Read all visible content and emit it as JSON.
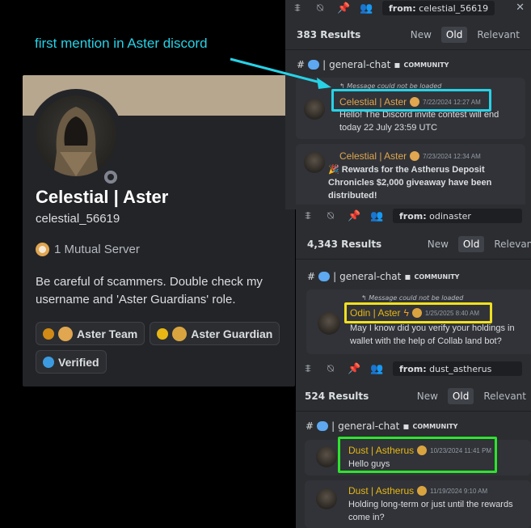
{
  "annotation": {
    "text": "first mention in Aster discord",
    "color": "#27d2e6"
  },
  "profile": {
    "display_name": "Celestial | Aster",
    "handle": "celestial_56619",
    "mutual": "1 Mutual Server",
    "bio": "Be careful of scammers. Double check my username and 'Aster Guardians' role.",
    "roles": [
      {
        "label": "Aster Team",
        "dot_color": "#d08a15"
      },
      {
        "label": "Aster Guardian",
        "dot_color": "#e8b713"
      },
      {
        "label": "Verified",
        "dot_color": "#3c9be0"
      }
    ]
  },
  "panels": [
    {
      "search": {
        "prefix": "from:",
        "query": "celestial_56619"
      },
      "results": "383 Results",
      "sort": [
        "New",
        "Old",
        "Relevant"
      ],
      "active_sort": "Old",
      "channel": "general-chat",
      "category": "COMMUNITY",
      "reply_note": "Message could not be loaded",
      "messages": [
        {
          "author": "Celestial | Aster",
          "time": "7/22/2024 12:27 AM",
          "lines": [
            "Hello! The Discord invite contest will end",
            "today 22 July 23:59 UTC"
          ]
        },
        {
          "author": "Celestial | Aster",
          "time": "7/23/2024 12:34 AM",
          "lines": [
            "🎉 Rewards for the Astherus Deposit",
            "Chronicles $2,000 giveaway have been",
            "distributed!"
          ]
        }
      ],
      "highlight_color": "#27d2e6"
    },
    {
      "search": {
        "prefix": "from:",
        "query": "odinaster"
      },
      "results": "4,343 Results",
      "sort": [
        "New",
        "Old",
        "Relevant"
      ],
      "active_sort": "Old",
      "channel": "general-chat",
      "category": "COMMUNITY",
      "reply_note": "Message could not be loaded",
      "messages": [
        {
          "author": "Odin | Aster",
          "time": "1/25/2025 8:40 AM",
          "lines": [
            "May I know did you verify your holdings in",
            "wallet with the help of Collab land bot?"
          ]
        }
      ],
      "highlight_color": "#f0e020"
    },
    {
      "search": {
        "prefix": "from:",
        "query": "dust_astherus"
      },
      "results": "524 Results",
      "sort": [
        "New",
        "Old",
        "Relevant"
      ],
      "active_sort": "Old",
      "channel": "general-chat",
      "category": "COMMUNITY",
      "messages": [
        {
          "author": "Dust | Astherus",
          "time": "10/23/2024 11:41 PM",
          "lines": [
            "Hello guys"
          ]
        },
        {
          "author": "Dust | Astherus",
          "time": "11/19/2024 9:10 AM",
          "lines": [
            "Holding long-term or just until the rewards",
            "come in?"
          ]
        }
      ],
      "highlight_color": "#2ee32e"
    }
  ],
  "icons": [
    "threads-icon",
    "mute-icon",
    "pin-icon",
    "members-icon",
    "close-icon",
    "hash-icon",
    "chat-bubble-icon",
    "folder-icon",
    "reply-icon",
    "verified-badge-icon"
  ]
}
